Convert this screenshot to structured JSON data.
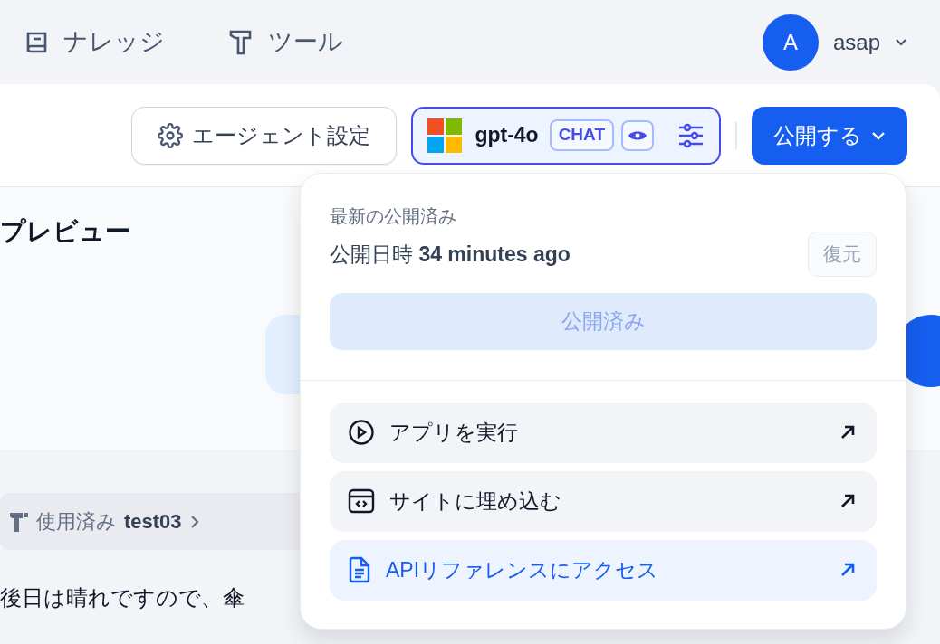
{
  "nav": {
    "items": [
      {
        "label": "ナレッジ",
        "kind": "book"
      },
      {
        "label": "ツール",
        "kind": "tool"
      }
    ],
    "user": {
      "avatar": "A",
      "name": "asap"
    }
  },
  "toolbar": {
    "agent_settings": "エージェント設定",
    "model": {
      "name": "gpt-4o",
      "tag": "CHAT"
    },
    "publish": "公開する"
  },
  "preview": {
    "title": "プレビュー",
    "tool_used": {
      "label": "使用済み",
      "name": "test03"
    },
    "message": "後日は晴れですので、傘"
  },
  "publish_menu": {
    "heading": "最新の公開済み",
    "published_label": "公開日時",
    "published_time": "34 minutes ago",
    "restore": {
      "label": "復元",
      "disabled": true
    },
    "publish_button": {
      "label": "公開済み",
      "disabled": true
    },
    "actions": [
      {
        "label": "アプリを実行",
        "kind": "run",
        "selected": false
      },
      {
        "label": "サイトに埋め込む",
        "kind": "embed",
        "selected": false
      },
      {
        "label": "APIリファレンスにアクセス",
        "kind": "api",
        "selected": true
      }
    ]
  }
}
